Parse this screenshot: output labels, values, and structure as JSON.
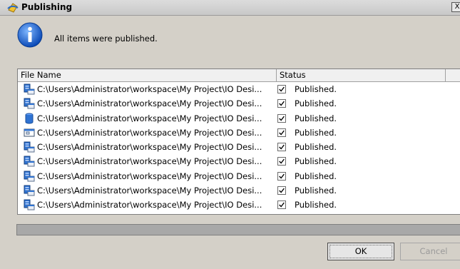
{
  "window": {
    "title": "Publishing",
    "close_label": "X"
  },
  "message": "All items were published.",
  "table": {
    "columns": [
      "File Name",
      "Status",
      ""
    ],
    "rows": [
      {
        "name": "C:\\Users\\Administrator\\workspace\\My Project\\IO Desi...",
        "status": "Published.",
        "icon": "server-component-icon",
        "checked": true
      },
      {
        "name": "C:\\Users\\Administrator\\workspace\\My Project\\IO Desi...",
        "status": "Published.",
        "icon": "server-component-icon",
        "checked": true
      },
      {
        "name": "C:\\Users\\Administrator\\workspace\\My Project\\IO Desi...",
        "status": "Published.",
        "icon": "database-icon",
        "checked": true
      },
      {
        "name": "C:\\Users\\Administrator\\workspace\\My Project\\IO Desi...",
        "status": "Published.",
        "icon": "window-icon",
        "checked": true
      },
      {
        "name": "C:\\Users\\Administrator\\workspace\\My Project\\IO Desi...",
        "status": "Published.",
        "icon": "server-component-icon",
        "checked": true
      },
      {
        "name": "C:\\Users\\Administrator\\workspace\\My Project\\IO Desi...",
        "status": "Published.",
        "icon": "server-component-icon",
        "checked": true
      },
      {
        "name": "C:\\Users\\Administrator\\workspace\\My Project\\IO Desi...",
        "status": "Published.",
        "icon": "server-component-icon",
        "checked": true
      },
      {
        "name": "C:\\Users\\Administrator\\workspace\\My Project\\IO Desi...",
        "status": "Published.",
        "icon": "server-component-icon",
        "checked": true
      },
      {
        "name": "C:\\Users\\Administrator\\workspace\\My Project\\IO Desi...",
        "status": "Published.",
        "icon": "server-component-icon",
        "checked": true
      }
    ]
  },
  "progress": {
    "fraction": 1.0
  },
  "buttons": {
    "ok": "OK",
    "cancel": "Cancel"
  }
}
